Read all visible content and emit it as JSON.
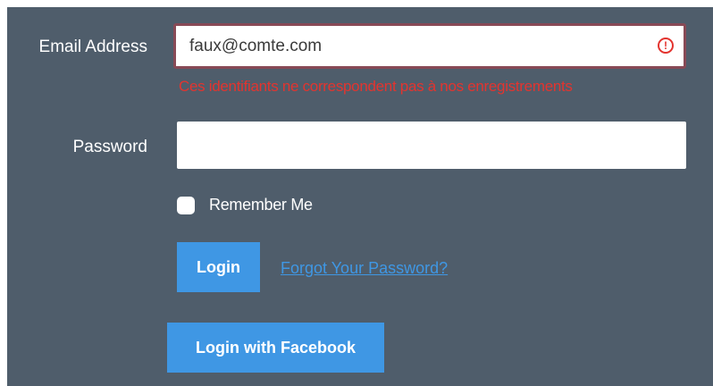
{
  "form": {
    "email": {
      "label": "Email Address",
      "value": "faux@comte.com",
      "error_icon": "error-circle-icon",
      "error_message": "Ces identifiants ne correspondent pas à nos enregistrements"
    },
    "password": {
      "label": "Password",
      "value": ""
    },
    "remember": {
      "label": "Remember Me",
      "checked": false
    },
    "login_button": "Login",
    "forgot_link": "Forgot Your Password?",
    "facebook_button": "Login with Facebook"
  },
  "colors": {
    "panel_background": "#4f5d6b",
    "accent": "#3f97e4",
    "error": "#e3342f",
    "error_border": "#884a56"
  }
}
